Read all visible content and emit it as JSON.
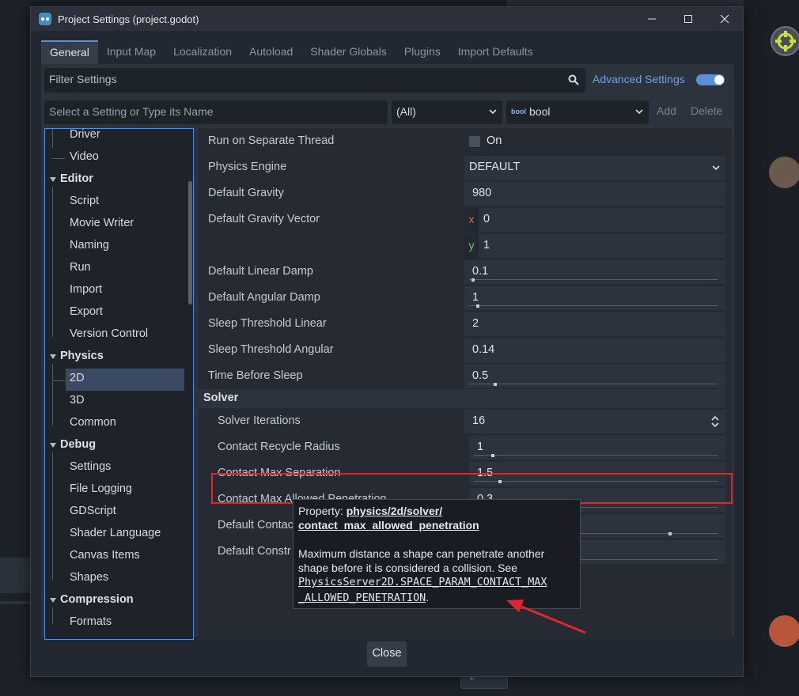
{
  "window": {
    "title": "Project Settings (project.godot)"
  },
  "tabs": [
    "General",
    "Input Map",
    "Localization",
    "Autoload",
    "Shader Globals",
    "Plugins",
    "Import Defaults"
  ],
  "filter": {
    "placeholder": "Filter Settings",
    "advanced_label": "Advanced Settings",
    "advanced_enabled": true
  },
  "add_setting": {
    "placeholder": "Select a Setting or Type its Name",
    "scope": "(All)",
    "type_icon": "bool",
    "type": "bool",
    "add_label": "Add",
    "delete_label": "Delete"
  },
  "tree": {
    "items": [
      {
        "label": "Driver",
        "level": 1
      },
      {
        "label": "Video",
        "level": 1
      },
      {
        "label": "Editor",
        "level": 0
      },
      {
        "label": "Script",
        "level": 1
      },
      {
        "label": "Movie Writer",
        "level": 1
      },
      {
        "label": "Naming",
        "level": 1
      },
      {
        "label": "Run",
        "level": 1
      },
      {
        "label": "Import",
        "level": 1
      },
      {
        "label": "Export",
        "level": 1
      },
      {
        "label": "Version Control",
        "level": 1
      },
      {
        "label": "Physics",
        "level": 0
      },
      {
        "label": "2D",
        "level": 1,
        "selected": true
      },
      {
        "label": "3D",
        "level": 1
      },
      {
        "label": "Common",
        "level": 1
      },
      {
        "label": "Debug",
        "level": 0
      },
      {
        "label": "Settings",
        "level": 1
      },
      {
        "label": "File Logging",
        "level": 1
      },
      {
        "label": "GDScript",
        "level": 1
      },
      {
        "label": "Shader Language",
        "level": 1
      },
      {
        "label": "Canvas Items",
        "level": 1
      },
      {
        "label": "Shapes",
        "level": 1
      },
      {
        "label": "Compression",
        "level": 0
      },
      {
        "label": "Formats",
        "level": 1
      }
    ]
  },
  "properties": {
    "run_on_separate_thread": {
      "label": "Run on Separate Thread",
      "value": "On",
      "checked": false
    },
    "physics_engine": {
      "label": "Physics Engine",
      "value": "DEFAULT"
    },
    "default_gravity": {
      "label": "Default Gravity",
      "value": "980"
    },
    "default_gravity_vector": {
      "label": "Default Gravity Vector",
      "x_label": "x",
      "x": "0",
      "y_label": "y",
      "y": "1"
    },
    "default_linear_damp": {
      "label": "Default Linear Damp",
      "value": "0.1",
      "slider": 0.01
    },
    "default_angular_damp": {
      "label": "Default Angular Damp",
      "value": "1",
      "slider": 0.03
    },
    "sleep_threshold_linear": {
      "label": "Sleep Threshold Linear",
      "value": "2"
    },
    "sleep_threshold_angular": {
      "label": "Sleep Threshold Angular",
      "value": "0.14"
    },
    "time_before_sleep": {
      "label": "Time Before Sleep",
      "value": "0.5",
      "slider": 0.1
    },
    "solver_section": "Solver",
    "solver_iterations": {
      "label": "Solver Iterations",
      "value": "16"
    },
    "contact_recycle_radius": {
      "label": "Contact Recycle Radius",
      "value": "1",
      "slider": 0.07
    },
    "contact_max_separation": {
      "label": "Contact Max Separation",
      "value": "1.5",
      "slider": 0.1
    },
    "contact_max_allowed_penetration": {
      "label": "Contact Max Allowed Penetration",
      "value": "0.3",
      "slider": 0.02
    },
    "default_contact_bias": {
      "label": "Default Contac",
      "slider": 0.8
    },
    "default_constraint_bias": {
      "label": "Default Constr"
    }
  },
  "tooltip": {
    "property_prefix": "Property: ",
    "property_path_1": "physics/2d/solver/",
    "property_path_2": "contact_max_allowed_penetration",
    "description_1": "Maximum distance a shape can penetrate another",
    "description_2": "shape before it is considered a collision. See",
    "code_1": "PhysicsServer2D.SPACE_PARAM_CONTACT_MAX",
    "code_2": "_ALLOWED_PENETRATION",
    "code_suffix": "."
  },
  "footer": {
    "close_label": "Close"
  },
  "background": {
    "badge_count": "2"
  },
  "colors": {
    "accent": "#5b8fd9",
    "highlight": "#e0262a",
    "axis_x": "#e0605c",
    "axis_y": "#7fc36a"
  }
}
